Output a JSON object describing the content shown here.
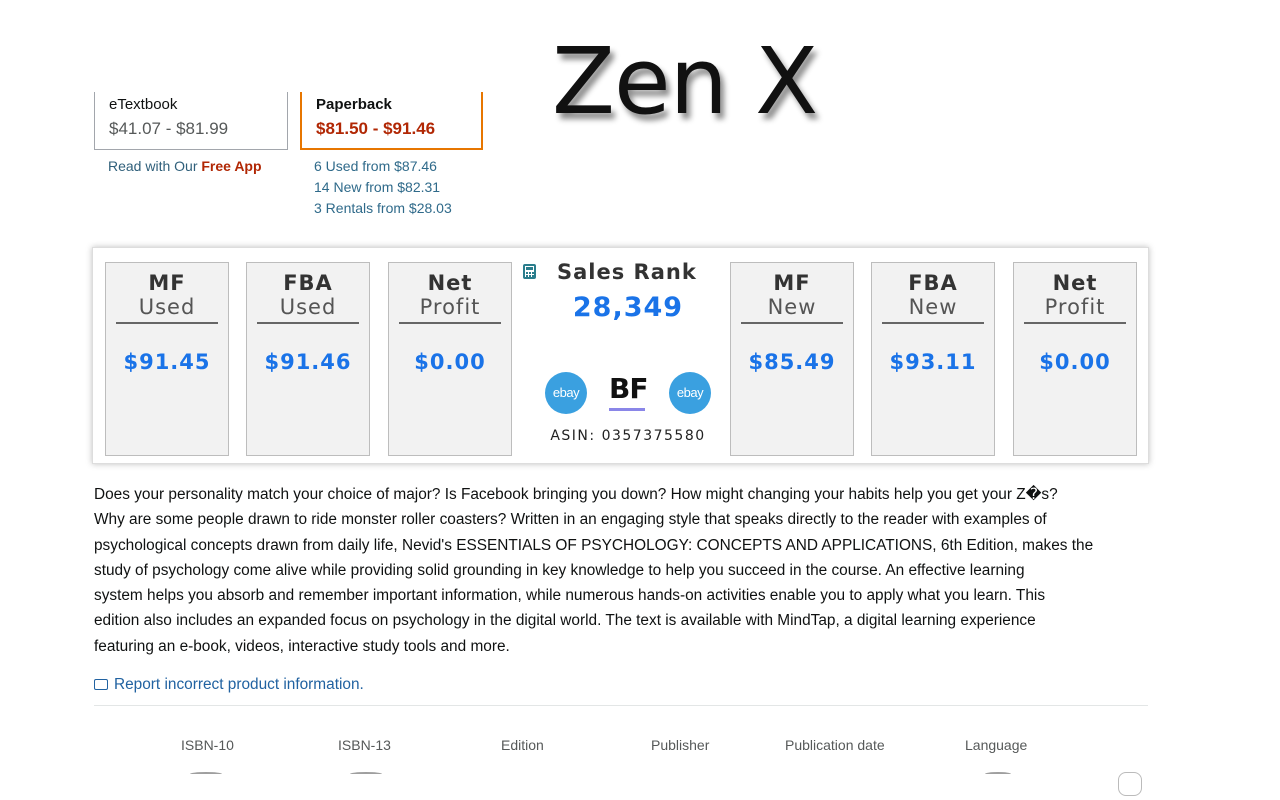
{
  "brand": {
    "title": "Zen X"
  },
  "formats": [
    {
      "name": "eTextbook",
      "price": "$41.07 - $81.99",
      "selected": false
    },
    {
      "name": "Paperback",
      "price": "$81.50 - $91.46",
      "selected": true
    }
  ],
  "etextbook_link": {
    "prefix": "Read with Our ",
    "bold": "Free App"
  },
  "offers": [
    "6 Used from $87.46",
    "14 New from $82.31",
    "3 Rentals from $28.03"
  ],
  "widget": {
    "cards_left": [
      {
        "line1": "MF",
        "line2": "Used",
        "value": "$91.45"
      },
      {
        "line1": "FBA",
        "line2": "Used",
        "value": "$91.46"
      },
      {
        "line1": "Net",
        "line2": "Profit",
        "value": "$0.00"
      }
    ],
    "sales_rank_label": "Sales Rank",
    "sales_rank_value": "28,349",
    "ebay_label": "ebay",
    "bf_label": "BF",
    "asin": "ASIN: 0357375580",
    "cards_right": [
      {
        "line1": "MF",
        "line2": "New",
        "value": "$85.49"
      },
      {
        "line1": "FBA",
        "line2": "New",
        "value": "$93.11"
      },
      {
        "line1": "Net",
        "line2": "Profit",
        "value": "$0.00"
      }
    ],
    "value_color": "#1a73e8"
  },
  "description": [
    "Does your personality match your choice of major? Is Facebook bringing you down? How might changing your habits help you get your Z�s?",
    "Why are some people drawn to ride monster roller coasters? Written in an engaging style that speaks directly to the reader with examples of",
    "psychological concepts drawn from daily life, Nevid's ESSENTIALS OF PSYCHOLOGY: CONCEPTS AND APPLICATIONS, 6th Edition, makes the",
    "study of psychology come alive while providing solid grounding in key knowledge to help you succeed in the course. An effective learning",
    "system helps you absorb and remember important information, while numerous hands-on activities enable you to apply what you learn. This",
    "edition also includes an expanded focus on psychology in the digital world. The text is available with MindTap, a digital learning experience",
    "featuring an e-book, videos, interactive study tools and more."
  ],
  "report_link": "Report incorrect product information.",
  "specs": [
    "ISBN-10",
    "ISBN-13",
    "Edition",
    "Publisher",
    "Publication date",
    "Language"
  ]
}
